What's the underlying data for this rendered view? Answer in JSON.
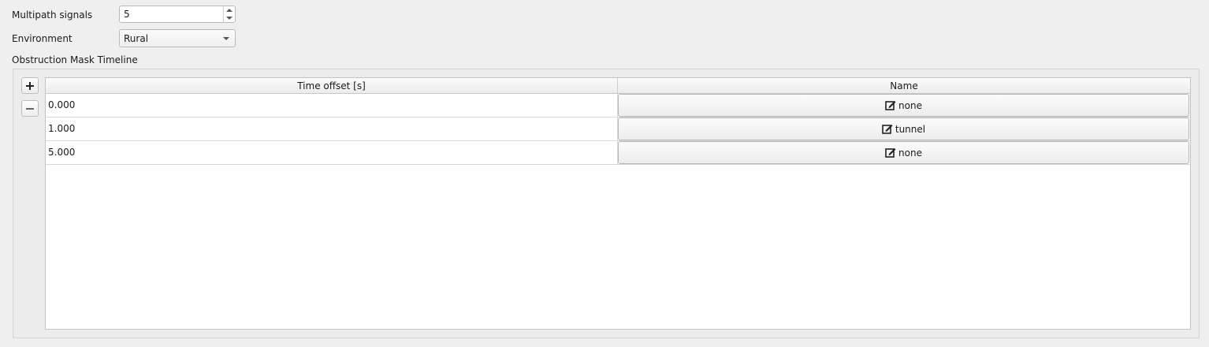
{
  "form": {
    "multipath_label": "Multipath signals",
    "multipath_value": "5",
    "environment_label": "Environment",
    "environment_value": "Rural",
    "obstruction_label": "Obstruction Mask Timeline"
  },
  "toolbar": {
    "add_icon": "plus-icon",
    "remove_icon": "minus-icon"
  },
  "table": {
    "headers": [
      "Time offset [s]",
      "Name"
    ],
    "rows": [
      {
        "time": "0.000",
        "name": "none"
      },
      {
        "time": "1.000",
        "name": "tunnel"
      },
      {
        "time": "5.000",
        "name": "none"
      }
    ],
    "name_icon": "edit-icon"
  }
}
